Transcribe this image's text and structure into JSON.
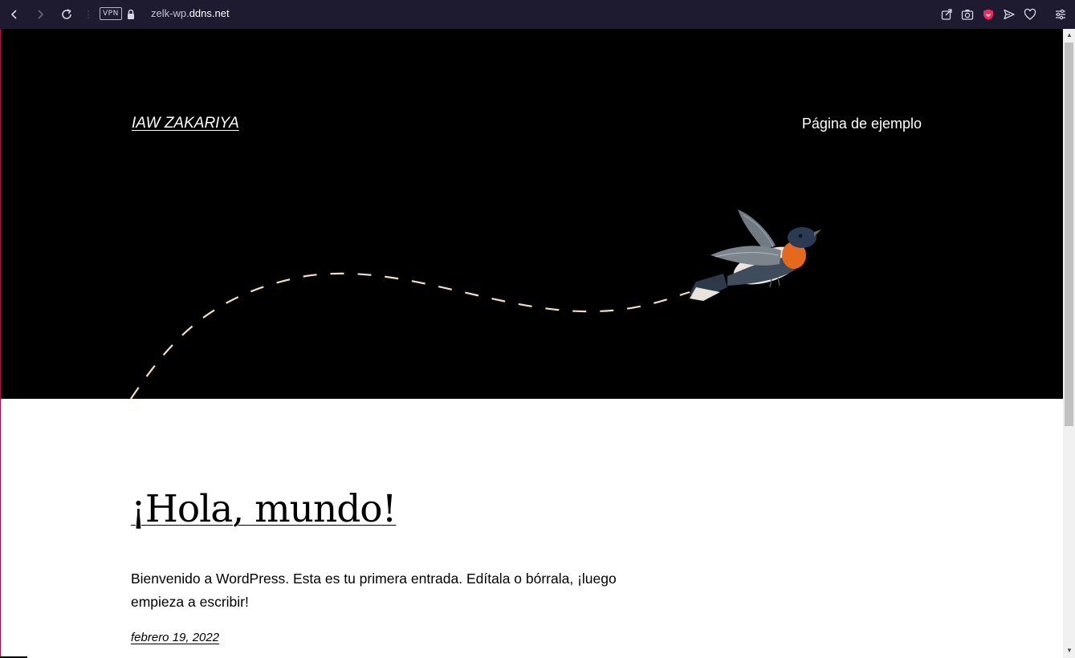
{
  "browser": {
    "vpn_label": "VPN",
    "url_prefix": "zelk-wp.",
    "url_domain": "ddns.net",
    "accent_color": "#f1295a",
    "toolbar_icons": [
      "back-icon",
      "forward-icon",
      "reload-icon",
      "lock-icon",
      "share-icon",
      "camera-icon",
      "shield-icon",
      "send-icon",
      "heart-icon",
      "menu-icon"
    ]
  },
  "header": {
    "site_title": "IAW ZAKARIYA",
    "nav_link": "Página de ejemplo"
  },
  "post": {
    "title": "¡Hola, mundo!",
    "excerpt": "Bienvenido a WordPress. Esta es tu primera entrada. Edítala o bórrala, ¡luego empieza a escribir!",
    "date": "febrero 19, 2022"
  }
}
